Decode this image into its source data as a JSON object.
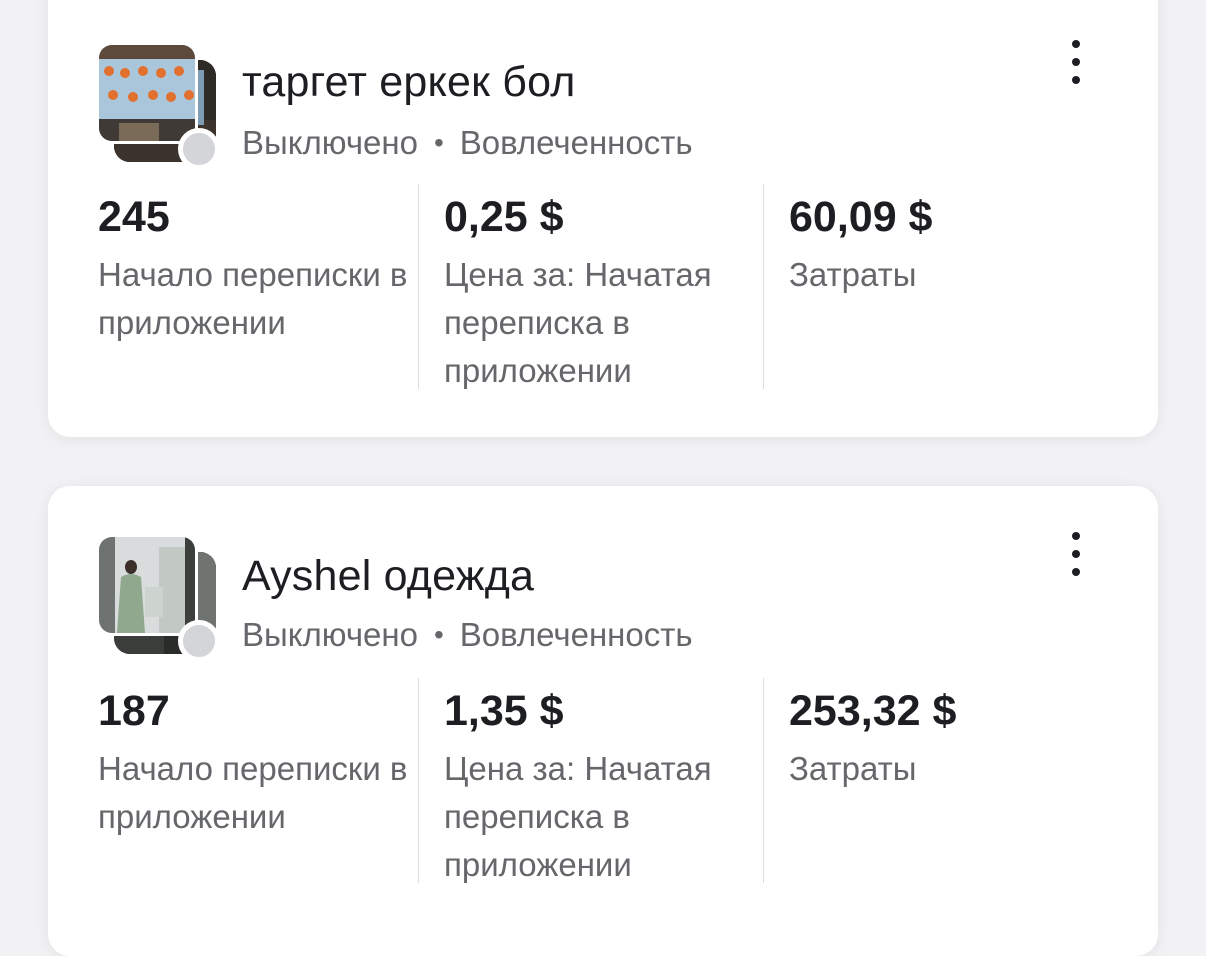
{
  "campaigns": [
    {
      "title": "таргет еркек бол",
      "status": "Выключено",
      "separator": "•",
      "objective": "Вовлеченность",
      "metrics": [
        {
          "value": "245",
          "label": "Начало переписки в приложении"
        },
        {
          "value": "0,25 $",
          "label": "Цена за: Начатая переписка в приложении"
        },
        {
          "value": "60,09 $",
          "label": "Затраты"
        }
      ]
    },
    {
      "title": "Ayshel одежда",
      "status": "Выключено",
      "separator": "•",
      "objective": "Вовлеченность",
      "metrics": [
        {
          "value": "187",
          "label": "Начало переписки в приложении"
        },
        {
          "value": "1,35 $",
          "label": "Цена за: Начатая переписка в приложении"
        },
        {
          "value": "253,32 $",
          "label": "Затраты"
        }
      ]
    }
  ],
  "icons": {
    "menu": "more-vertical-icon",
    "status": "status-dot-off"
  },
  "colors": {
    "primary_text": "#1c1e21",
    "secondary_text": "#65676b",
    "status_off": "#d4d5d8",
    "divider": "#dadde1"
  }
}
